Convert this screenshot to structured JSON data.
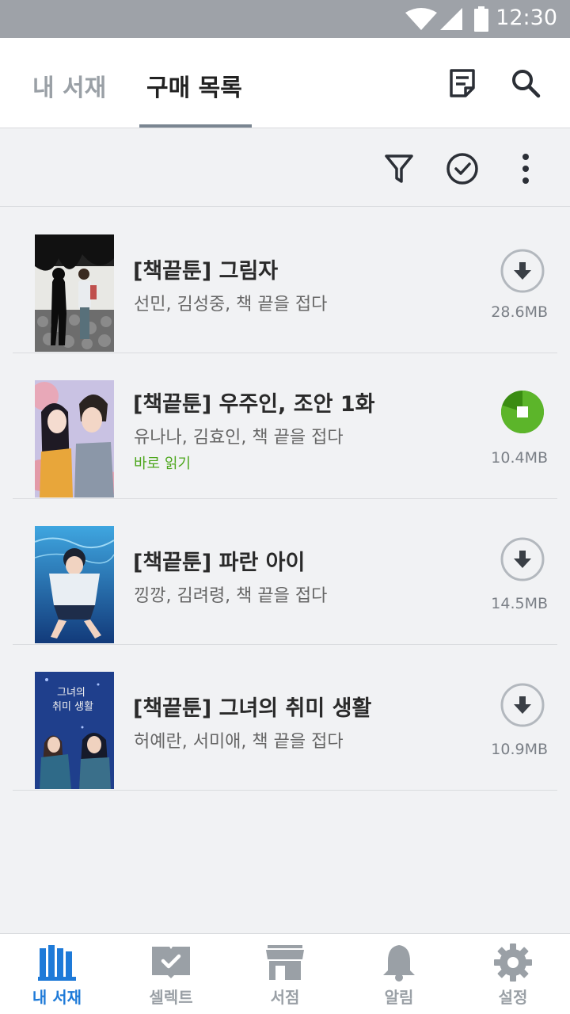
{
  "status_bar": {
    "time": "12:30",
    "icons": [
      "wifi-icon",
      "signal-icon",
      "battery-icon"
    ]
  },
  "header": {
    "tabs": [
      {
        "label": "내 서재",
        "active": false
      },
      {
        "label": "구매 목록",
        "active": true
      }
    ],
    "icons": [
      "notes-icon",
      "search-icon"
    ]
  },
  "toolbar": {
    "icons": [
      "filter-icon",
      "select-check-icon",
      "more-vert-icon"
    ]
  },
  "books": [
    {
      "title": "[책끝툰] 그림자",
      "author": "선민, 김성중, 책 끝을 접다",
      "size": "28.6MB",
      "state": "download"
    },
    {
      "title": "[책끝툰] 우주인, 조안 1화",
      "author": "유나나, 김효인, 책 끝을 접다",
      "size": "10.4MB",
      "state": "downloading",
      "progress": 0.8,
      "read_now": "바로 읽기"
    },
    {
      "title": "[책끝툰] 파란 아이",
      "author": "낑깡, 김려령, 책 끝을 접다",
      "size": "14.5MB",
      "state": "download"
    },
    {
      "title": "[책끝툰] 그녀의 취미 생활",
      "author": "허예란, 서미애, 책 끝을 접다",
      "size": "10.9MB",
      "state": "download",
      "cover_text": [
        "그녀의",
        "취미 생활"
      ]
    }
  ],
  "bottom_nav": [
    {
      "label": "내 서재",
      "icon": "library-icon",
      "active": true
    },
    {
      "label": "셀렉트",
      "icon": "select-book-icon",
      "active": false
    },
    {
      "label": "서점",
      "icon": "store-icon",
      "active": false
    },
    {
      "label": "알림",
      "icon": "bell-icon",
      "active": false
    },
    {
      "label": "설정",
      "icon": "gear-icon",
      "active": false
    }
  ],
  "colors": {
    "accent": "#1e7ad8",
    "progress": "#4ca61b",
    "status_bar": "#9ea2a8"
  }
}
